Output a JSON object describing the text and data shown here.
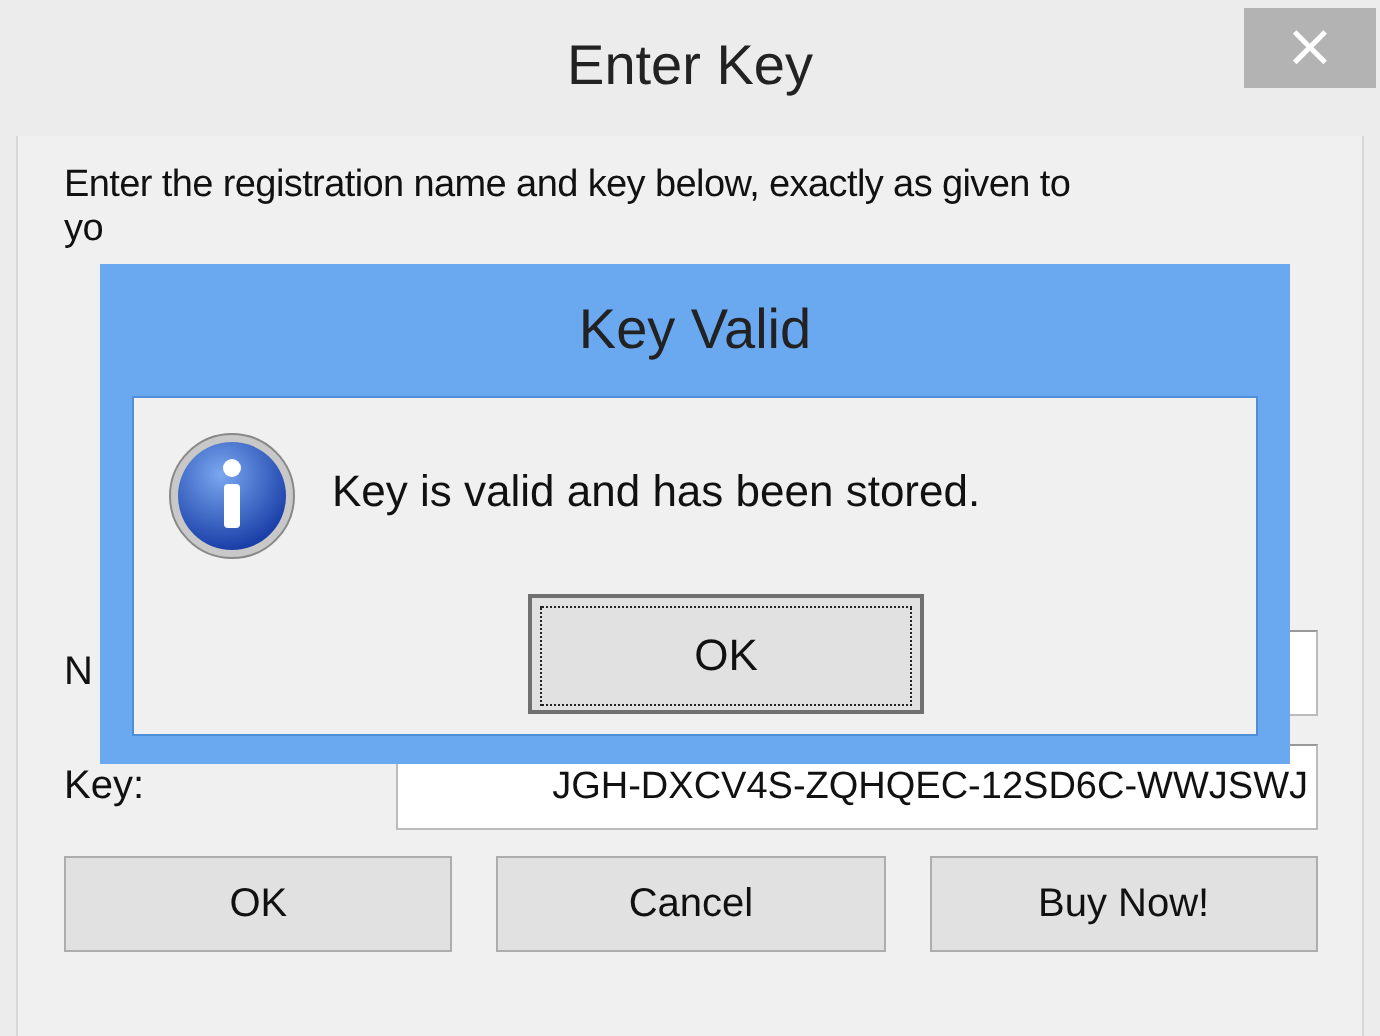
{
  "window": {
    "title": "Enter Key",
    "close": "×"
  },
  "instructions": "Enter the registration name and key below, exactly as given to yo",
  "fields": [
    {
      "label": "N"
    },
    {
      "label": "Key:",
      "value": "JGH-DXCV4S-ZQHQEC-12SD6C-WWJSWJ"
    }
  ],
  "buttons": [
    "OK",
    "Cancel",
    "Buy Now!"
  ],
  "modal": {
    "title": "Key Valid",
    "message": "Key is valid and has been stored.",
    "button": "OK"
  }
}
